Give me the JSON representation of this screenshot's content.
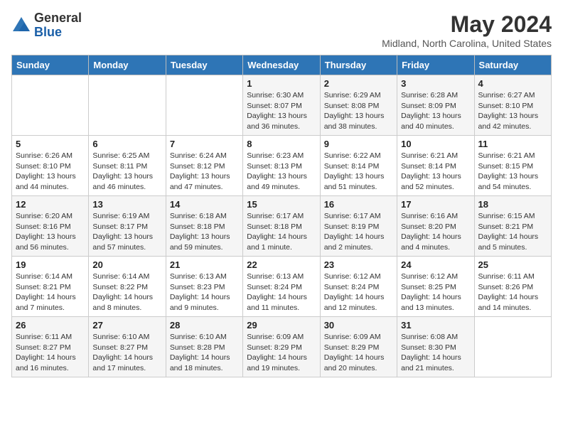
{
  "header": {
    "logo_general": "General",
    "logo_blue": "Blue",
    "title": "May 2024",
    "location": "Midland, North Carolina, United States"
  },
  "days_of_week": [
    "Sunday",
    "Monday",
    "Tuesday",
    "Wednesday",
    "Thursday",
    "Friday",
    "Saturday"
  ],
  "weeks": [
    [
      {
        "day": "",
        "info": ""
      },
      {
        "day": "",
        "info": ""
      },
      {
        "day": "",
        "info": ""
      },
      {
        "day": "1",
        "info": "Sunrise: 6:30 AM\nSunset: 8:07 PM\nDaylight: 13 hours and 36 minutes."
      },
      {
        "day": "2",
        "info": "Sunrise: 6:29 AM\nSunset: 8:08 PM\nDaylight: 13 hours and 38 minutes."
      },
      {
        "day": "3",
        "info": "Sunrise: 6:28 AM\nSunset: 8:09 PM\nDaylight: 13 hours and 40 minutes."
      },
      {
        "day": "4",
        "info": "Sunrise: 6:27 AM\nSunset: 8:10 PM\nDaylight: 13 hours and 42 minutes."
      }
    ],
    [
      {
        "day": "5",
        "info": "Sunrise: 6:26 AM\nSunset: 8:10 PM\nDaylight: 13 hours and 44 minutes."
      },
      {
        "day": "6",
        "info": "Sunrise: 6:25 AM\nSunset: 8:11 PM\nDaylight: 13 hours and 46 minutes."
      },
      {
        "day": "7",
        "info": "Sunrise: 6:24 AM\nSunset: 8:12 PM\nDaylight: 13 hours and 47 minutes."
      },
      {
        "day": "8",
        "info": "Sunrise: 6:23 AM\nSunset: 8:13 PM\nDaylight: 13 hours and 49 minutes."
      },
      {
        "day": "9",
        "info": "Sunrise: 6:22 AM\nSunset: 8:14 PM\nDaylight: 13 hours and 51 minutes."
      },
      {
        "day": "10",
        "info": "Sunrise: 6:21 AM\nSunset: 8:14 PM\nDaylight: 13 hours and 52 minutes."
      },
      {
        "day": "11",
        "info": "Sunrise: 6:21 AM\nSunset: 8:15 PM\nDaylight: 13 hours and 54 minutes."
      }
    ],
    [
      {
        "day": "12",
        "info": "Sunrise: 6:20 AM\nSunset: 8:16 PM\nDaylight: 13 hours and 56 minutes."
      },
      {
        "day": "13",
        "info": "Sunrise: 6:19 AM\nSunset: 8:17 PM\nDaylight: 13 hours and 57 minutes."
      },
      {
        "day": "14",
        "info": "Sunrise: 6:18 AM\nSunset: 8:18 PM\nDaylight: 13 hours and 59 minutes."
      },
      {
        "day": "15",
        "info": "Sunrise: 6:17 AM\nSunset: 8:18 PM\nDaylight: 14 hours and 1 minute."
      },
      {
        "day": "16",
        "info": "Sunrise: 6:17 AM\nSunset: 8:19 PM\nDaylight: 14 hours and 2 minutes."
      },
      {
        "day": "17",
        "info": "Sunrise: 6:16 AM\nSunset: 8:20 PM\nDaylight: 14 hours and 4 minutes."
      },
      {
        "day": "18",
        "info": "Sunrise: 6:15 AM\nSunset: 8:21 PM\nDaylight: 14 hours and 5 minutes."
      }
    ],
    [
      {
        "day": "19",
        "info": "Sunrise: 6:14 AM\nSunset: 8:21 PM\nDaylight: 14 hours and 7 minutes."
      },
      {
        "day": "20",
        "info": "Sunrise: 6:14 AM\nSunset: 8:22 PM\nDaylight: 14 hours and 8 minutes."
      },
      {
        "day": "21",
        "info": "Sunrise: 6:13 AM\nSunset: 8:23 PM\nDaylight: 14 hours and 9 minutes."
      },
      {
        "day": "22",
        "info": "Sunrise: 6:13 AM\nSunset: 8:24 PM\nDaylight: 14 hours and 11 minutes."
      },
      {
        "day": "23",
        "info": "Sunrise: 6:12 AM\nSunset: 8:24 PM\nDaylight: 14 hours and 12 minutes."
      },
      {
        "day": "24",
        "info": "Sunrise: 6:12 AM\nSunset: 8:25 PM\nDaylight: 14 hours and 13 minutes."
      },
      {
        "day": "25",
        "info": "Sunrise: 6:11 AM\nSunset: 8:26 PM\nDaylight: 14 hours and 14 minutes."
      }
    ],
    [
      {
        "day": "26",
        "info": "Sunrise: 6:11 AM\nSunset: 8:27 PM\nDaylight: 14 hours and 16 minutes."
      },
      {
        "day": "27",
        "info": "Sunrise: 6:10 AM\nSunset: 8:27 PM\nDaylight: 14 hours and 17 minutes."
      },
      {
        "day": "28",
        "info": "Sunrise: 6:10 AM\nSunset: 8:28 PM\nDaylight: 14 hours and 18 minutes."
      },
      {
        "day": "29",
        "info": "Sunrise: 6:09 AM\nSunset: 8:29 PM\nDaylight: 14 hours and 19 minutes."
      },
      {
        "day": "30",
        "info": "Sunrise: 6:09 AM\nSunset: 8:29 PM\nDaylight: 14 hours and 20 minutes."
      },
      {
        "day": "31",
        "info": "Sunrise: 6:08 AM\nSunset: 8:30 PM\nDaylight: 14 hours and 21 minutes."
      },
      {
        "day": "",
        "info": ""
      }
    ]
  ]
}
